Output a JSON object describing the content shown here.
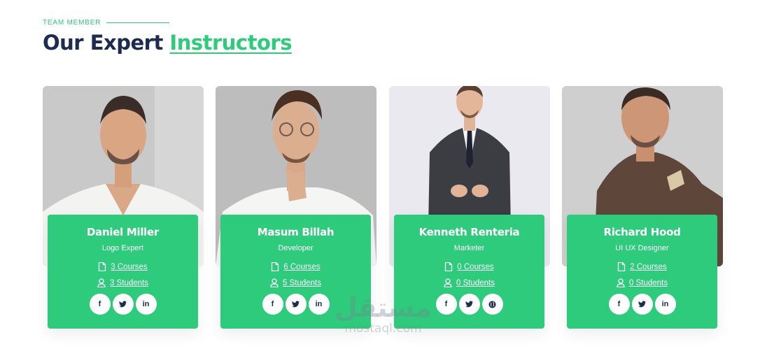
{
  "section": {
    "eyebrow": "TEAM MEMBER",
    "title_main": "Our Expert ",
    "title_accent": "Instructors"
  },
  "colors": {
    "accent": "#2ecc7a",
    "heading": "#1c2b4f",
    "card": "#2fcb7c"
  },
  "instructors": [
    {
      "name": "Daniel Miller",
      "role": "Logo Expert",
      "courses": "3 Courses",
      "students": "3 Students",
      "socials": [
        "f",
        "t",
        "in"
      ]
    },
    {
      "name": "Masum Billah",
      "role": "Developer",
      "courses": "6 Courses",
      "students": "5 Students",
      "socials": [
        "f",
        "t",
        "in"
      ]
    },
    {
      "name": "Kenneth Renteria",
      "role": "Marketer",
      "courses": "0 Courses",
      "students": "0 Students",
      "socials": [
        "f",
        "t",
        "globe"
      ]
    },
    {
      "name": "Richard Hood",
      "role": "UI UX Designer",
      "courses": "2 Courses",
      "students": "0 Students",
      "socials": [
        "f",
        "t",
        "in"
      ]
    }
  ],
  "icons": {
    "courses": "file-icon",
    "students": "user-icon",
    "facebook": "facebook-icon",
    "twitter": "twitter-icon",
    "linkedin": "linkedin-icon",
    "globe": "globe-icon"
  },
  "watermark": {
    "arabic": "مستقل",
    "latin": "mostaql.com"
  }
}
